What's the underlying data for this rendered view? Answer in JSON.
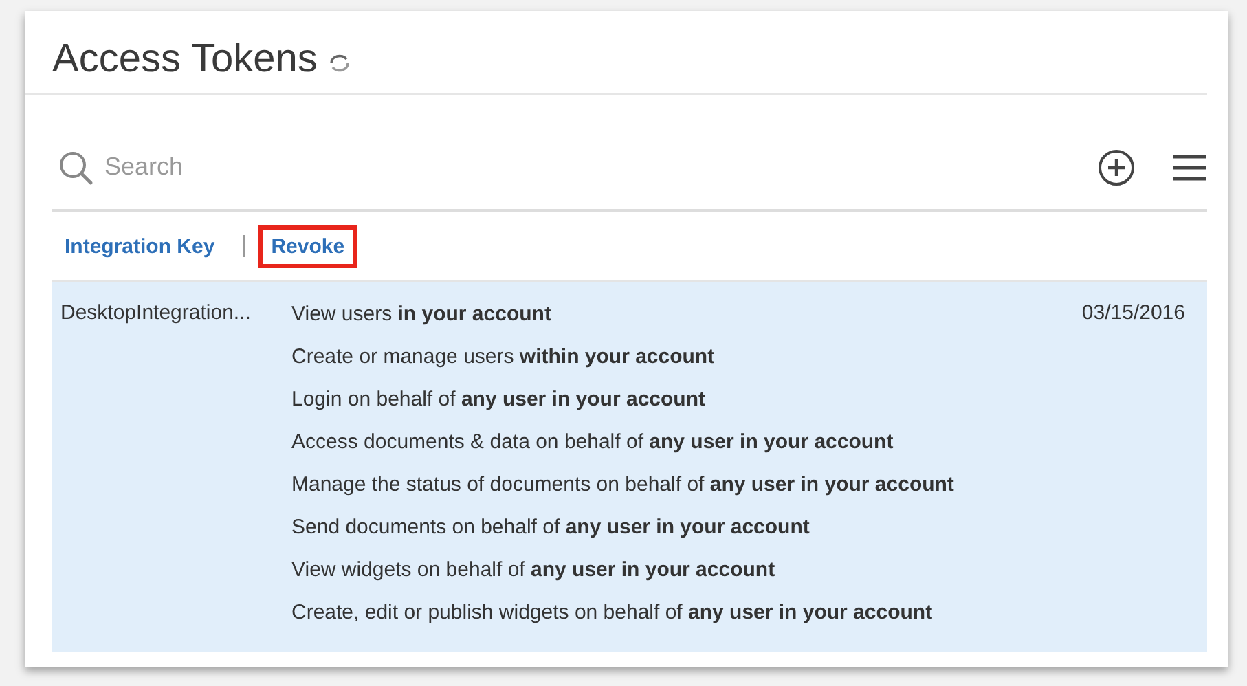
{
  "page": {
    "title": "Access Tokens"
  },
  "search": {
    "placeholder": "Search"
  },
  "actions": [
    {
      "label": "Integration Key",
      "highlighted": false
    },
    {
      "label": "Revoke",
      "highlighted": true
    }
  ],
  "table": {
    "rows": [
      {
        "selected": true,
        "name": "DesktopIntegration...",
        "date": "03/15/2016",
        "scopes": [
          "View users **in your account**",
          "Create or manage users **within your account**",
          "Login on behalf of **any user in your account**",
          "Access documents & data on behalf of **any user in your account**",
          "Manage the status of documents on behalf of **any user in your account**",
          "Send documents on behalf of **any user in your account**",
          "View widgets on behalf of **any user in your account**",
          "Create, edit or publish widgets on behalf of **any user in your account**"
        ]
      }
    ]
  }
}
